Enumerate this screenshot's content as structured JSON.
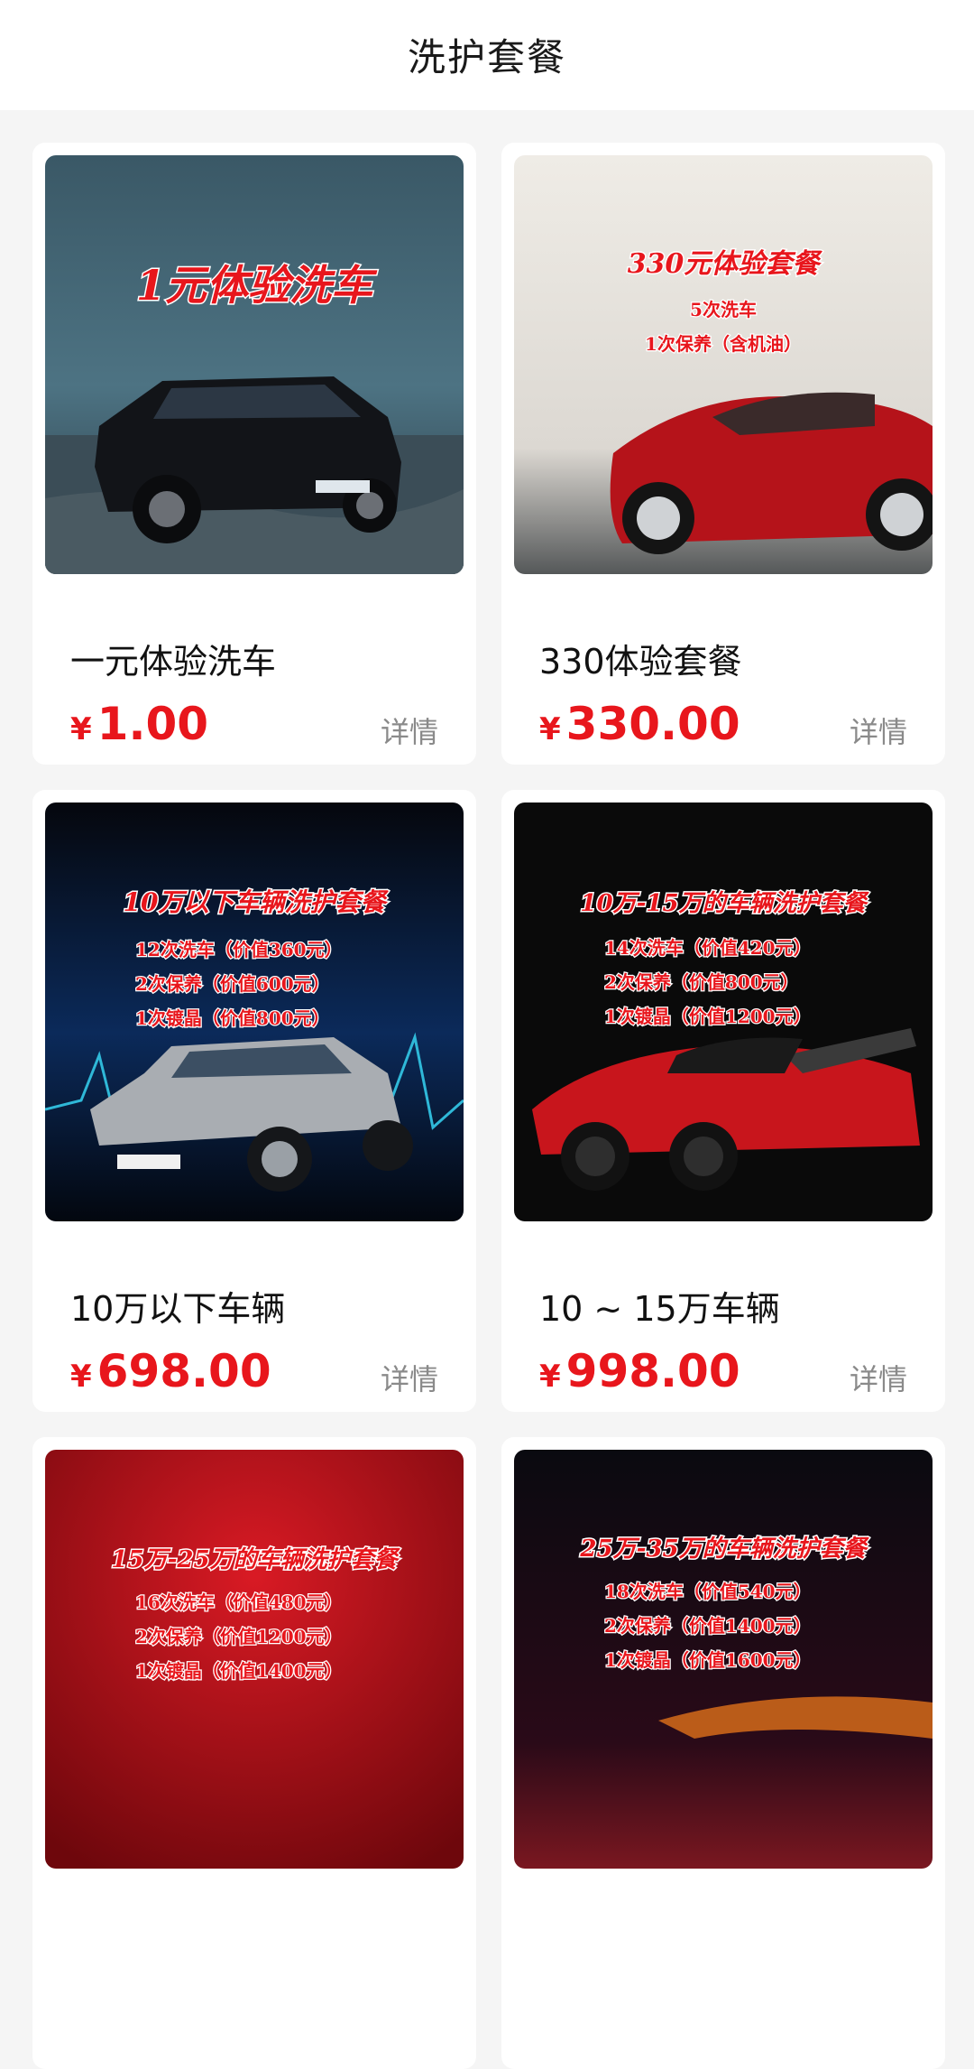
{
  "header": {
    "title": "洗护套餐"
  },
  "packages": [
    {
      "name": "一元体验洗车",
      "currency": "¥",
      "price": "1.00",
      "detail": "详情",
      "poster": {
        "title": "1元体验洗车",
        "lines": []
      }
    },
    {
      "name": "330体验套餐",
      "currency": "¥",
      "price": "330.00",
      "detail": "详情",
      "poster": {
        "title": "330元体验套餐",
        "lines": [
          "5次洗车",
          "1次保养（含机油）"
        ]
      }
    },
    {
      "name": "10万以下车辆",
      "currency": "¥",
      "price": "698.00",
      "detail": "详情",
      "poster": {
        "title": "10万以下车辆洗护套餐",
        "lines": [
          "12次洗车（价值360元）",
          "2次保养（价值600元）",
          "1次镀晶（价值800元）"
        ]
      }
    },
    {
      "name": "10 ~ 15万车辆",
      "currency": "¥",
      "price": "998.00",
      "detail": "详情",
      "poster": {
        "title": "10万-15万的车辆洗护套餐",
        "lines": [
          "14次洗车（价值420元）",
          "2次保养（价值800元）",
          "1次镀晶（价值1200元）"
        ]
      }
    },
    {
      "poster": {
        "title": "15万-25万的车辆洗护套餐",
        "lines": [
          "16次洗车（价值480元）",
          "2次保养（价值1200元）",
          "1次镀晶（价值1400元）"
        ]
      }
    },
    {
      "poster": {
        "title": "25万-35万的车辆洗护套餐",
        "lines": [
          "18次洗车（价值540元）",
          "2次保养（价值1400元）",
          "1次镀晶（价值1600元）"
        ]
      }
    }
  ],
  "colors": {
    "price": "#e8161c",
    "detail": "#8a8a8a",
    "background": "#f5f5f5"
  }
}
